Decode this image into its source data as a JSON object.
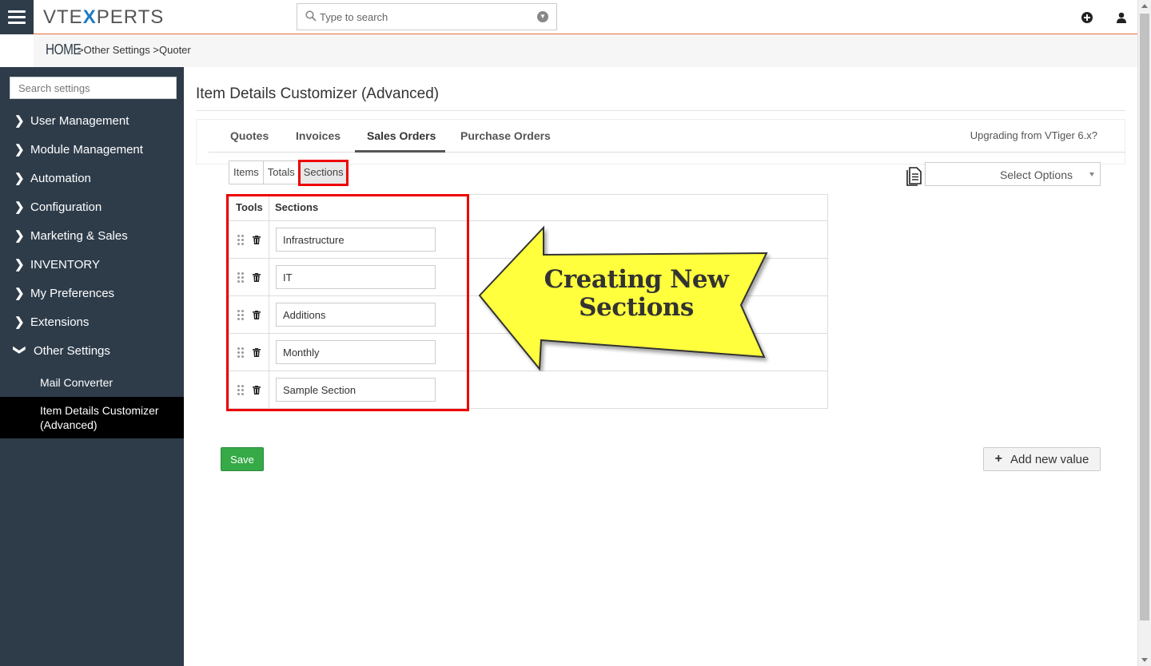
{
  "header": {
    "logo_left": "VTE",
    "logo_x": "X",
    "logo_right": "PERTS",
    "search_placeholder": "Type to search"
  },
  "breadcrumb": {
    "home": "HOME",
    "items": [
      ">Other Settings >",
      "Quoter"
    ]
  },
  "sidebar": {
    "search_placeholder": "Search settings",
    "items": [
      {
        "label": "User Management"
      },
      {
        "label": "Module Management"
      },
      {
        "label": "Automation"
      },
      {
        "label": "Configuration"
      },
      {
        "label": "Marketing & Sales"
      },
      {
        "label": "INVENTORY"
      },
      {
        "label": "My Preferences"
      },
      {
        "label": "Extensions"
      },
      {
        "label": "Other Settings"
      }
    ],
    "sub_items": [
      {
        "label": "Mail Converter"
      },
      {
        "label": "Item Details Customizer (Advanced)"
      }
    ]
  },
  "main": {
    "title": "Item Details Customizer (Advanced)",
    "tabs": [
      {
        "label": "Quotes"
      },
      {
        "label": "Invoices"
      },
      {
        "label": "Sales Orders"
      },
      {
        "label": "Purchase Orders"
      }
    ],
    "upgrade_link": "Upgrading from VTiger 6.x?",
    "subtabs": [
      {
        "label": "Items"
      },
      {
        "label": "Totals"
      },
      {
        "label": "Sections"
      }
    ],
    "select_options": "Select Options",
    "table": {
      "headers": [
        "Tools",
        "Sections"
      ],
      "rows": [
        {
          "value": "Infrastructure"
        },
        {
          "value": "IT"
        },
        {
          "value": "Additions"
        },
        {
          "value": "Monthly"
        },
        {
          "value": "Sample Section"
        }
      ]
    },
    "annotation": {
      "line1": "Creating New",
      "line2": "Sections"
    },
    "save_label": "Save",
    "add_new_label": "Add new value"
  },
  "colors": {
    "sidebar_bg": "#2e3c4a",
    "accent_orange": "#e8703a",
    "save_green": "#35aa47",
    "highlight_red": "#ee0000",
    "arrow_yellow": "#ffff3c"
  }
}
